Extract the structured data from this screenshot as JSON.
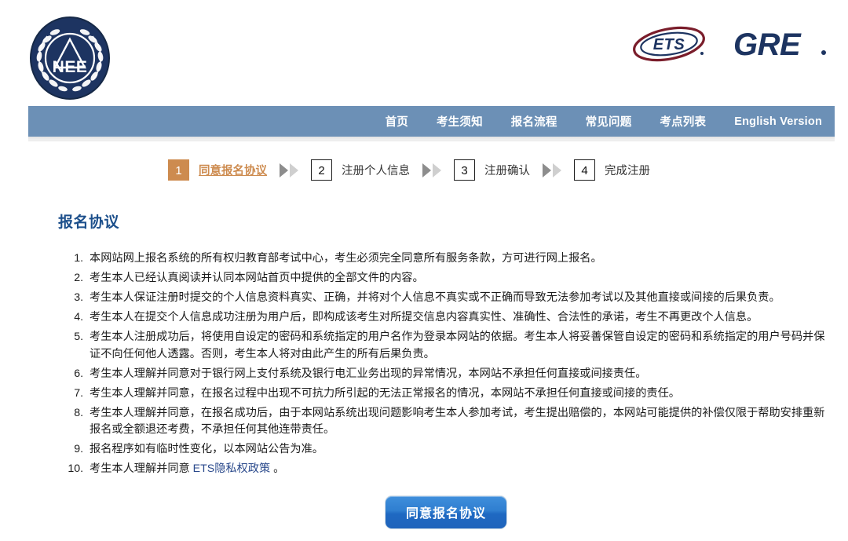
{
  "header": {
    "org_logo_alt": "NEE",
    "org_logo_text": "NEE",
    "ets_logo_text": "ETS",
    "gre_logo_text": "GRE"
  },
  "nav": {
    "items": [
      {
        "label": "首页",
        "name": "nav-item-home"
      },
      {
        "label": "考生须知",
        "name": "nav-item-notice"
      },
      {
        "label": "报名流程",
        "name": "nav-item-process"
      },
      {
        "label": "常见问题",
        "name": "nav-item-faq"
      },
      {
        "label": "考点列表",
        "name": "nav-item-centers"
      },
      {
        "label": "English Version",
        "name": "nav-item-english"
      }
    ]
  },
  "steps": [
    {
      "num": "1",
      "label": "同意报名协议",
      "active": true
    },
    {
      "num": "2",
      "label": "注册个人信息",
      "active": false
    },
    {
      "num": "3",
      "label": "注册确认",
      "active": false
    },
    {
      "num": "4",
      "label": "完成注册",
      "active": false
    }
  ],
  "main": {
    "title": "报名协议",
    "terms": [
      "本网站网上报名系统的所有权归教育部考试中心，考生必须完全同意所有服务条款，方可进行网上报名。",
      "考生本人已经认真阅读并认同本网站首页中提供的全部文件的内容。",
      "考生本人保证注册时提交的个人信息资料真实、正确，并将对个人信息不真实或不正确而导致无法参加考试以及其他直接或间接的后果负责。",
      "考生本人在提交个人信息成功注册为用户后，即构成该考生对所提交信息内容真实性、准确性、合法性的承诺，考生不再更改个人信息。",
      "考生本人注册成功后，将使用自设定的密码和系统指定的用户名作为登录本网站的依据。考生本人将妥善保管自设定的密码和系统指定的用户号码并保证不向任何他人透露。否则，考生本人将对由此产生的所有后果负责。",
      "考生本人理解并同意对于银行网上支付系统及银行电汇业务出现的异常情况，本网站不承担任何直接或间接责任。",
      "考生本人理解并同意，在报名过程中出现不可抗力所引起的无法正常报名的情况，本网站不承担任何直接或间接的责任。",
      "考生本人理解并同意，在报名成功后，由于本网站系统出现问题影响考生本人参加考试，考生提出赔偿的，本网站可能提供的补偿仅限于帮助安排重新报名或全额退还考费，不承担任何其他连带责任。",
      "报名程序如有临时性变化，以本网站公告为准。"
    ],
    "term10_prefix": "考生本人理解并同意 ",
    "term10_link": "ETS隐私权政策",
    "term10_suffix": " 。"
  },
  "submit": {
    "label": "同意报名协议"
  },
  "colors": {
    "nav_bar": "#6c90b6",
    "accent_orange": "#cd8b4f",
    "title_blue": "#1c4f8b",
    "link_blue": "#2b4a8c",
    "button_blue": "#2f7ed0",
    "logo_navy": "#1d3461"
  }
}
